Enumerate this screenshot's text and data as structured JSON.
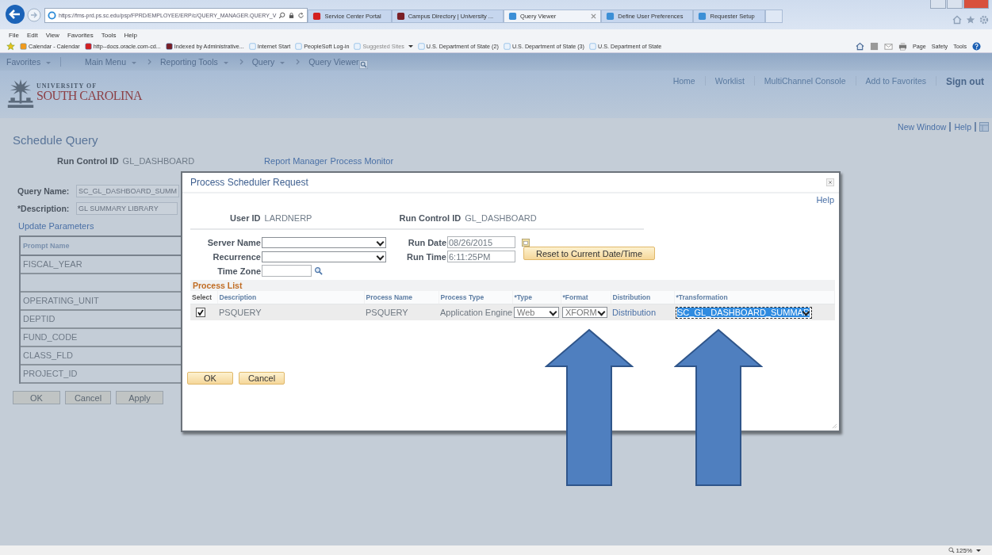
{
  "browser": {
    "address": "https://fms-prd.ps.sc.edu/psp/FPRD/EMPLOYEE/ERP/c/QUERY_MANAGER.QUERY_V",
    "tabs": [
      {
        "label": "Service Center Portal",
        "selected": false
      },
      {
        "label": "Campus Directory | University ...",
        "selected": false
      },
      {
        "label": "Query Viewer",
        "selected": true
      },
      {
        "label": "Define User Preferences",
        "selected": false
      },
      {
        "label": "Requester Setup",
        "selected": false
      }
    ],
    "menu": [
      "File",
      "Edit",
      "View",
      "Favorites",
      "Tools",
      "Help"
    ],
    "favorites": [
      {
        "label": "Calendar - Calendar",
        "dropdown": false
      },
      {
        "label": "http--docs.oracle.com-cd...",
        "dropdown": false
      },
      {
        "label": "Indexed by Administrative...",
        "dropdown": false
      },
      {
        "label": "Internet Start",
        "dropdown": false
      },
      {
        "label": "PeopleSoft Log-in",
        "dropdown": false
      },
      {
        "label": "Suggested Sites",
        "dropdown": true
      },
      {
        "label": "U.S. Department of State (2)",
        "dropdown": false
      },
      {
        "label": "U.S. Department of State (3)",
        "dropdown": false
      },
      {
        "label": "U.S. Department of State",
        "dropdown": false
      }
    ],
    "commands": [
      "Page",
      "Safety",
      "Tools"
    ],
    "zoom": "125%"
  },
  "nav": {
    "favorites": "Favorites",
    "main_menu": "Main Menu",
    "breadcrumbs": [
      {
        "label": "Reporting Tools",
        "dropdown": true
      },
      {
        "label": "Query",
        "dropdown": true
      },
      {
        "label": "Query Viewer",
        "dropdown": false
      }
    ]
  },
  "header": {
    "logo_top": "UNIVERSITY OF",
    "logo_bottom": "SOUTH CAROLINA",
    "links": [
      "Home",
      "Worklist",
      "MultiChannel Console",
      "Add to Favorites",
      "Sign out"
    ]
  },
  "page": {
    "top_links": [
      "New Window",
      "Help"
    ],
    "title": "Schedule Query",
    "run_control_label": "Run Control ID",
    "run_control_value": "GL_DASHBOARD",
    "links": [
      "Report Manager",
      "Process Monitor"
    ],
    "query_name_label": "Query Name:",
    "query_name_value": "SC_GL_DASHBOARD_SUMM",
    "description_label": "*Description:",
    "description_value": "GL SUMMARY LIBRARY",
    "update_parameters": "Update Parameters",
    "prompt_header": "Prompt Name",
    "prompts": [
      {
        "kind": "prompt",
        "name": "FISCAL_YEAR"
      },
      {
        "kind": "blank"
      },
      {
        "kind": "prompt",
        "name": "OPERATING_UNIT"
      },
      {
        "kind": "prompt",
        "name": "DEPTID"
      },
      {
        "kind": "prompt",
        "name": "FUND_CODE"
      },
      {
        "kind": "prompt",
        "name": "CLASS_FLD"
      },
      {
        "kind": "prompt",
        "name": "PROJECT_ID"
      }
    ],
    "buttons": [
      "OK",
      "Cancel",
      "Apply"
    ]
  },
  "dialog": {
    "title": "Process Scheduler Request",
    "help": "Help",
    "user_id_label": "User ID",
    "user_id": "LARDNERP",
    "run_control_label": "Run Control ID",
    "run_control": "GL_DASHBOARD",
    "server_name_label": "Server Name",
    "recurrence_label": "Recurrence",
    "time_zone_label": "Time Zone",
    "run_date_label": "Run Date",
    "run_date": "08/26/2015",
    "run_time_label": "Run Time",
    "run_time": "6:11:25PM",
    "reset_button": "Reset to Current Date/Time",
    "process_list_title": "Process List",
    "columns": [
      "Select",
      "Description",
      "Process Name",
      "Process Type",
      "*Type",
      "*Format",
      "Distribution",
      "*Transformation"
    ],
    "rows": [
      {
        "checked": true,
        "description": "PSQUERY",
        "process_name": "PSQUERY",
        "process_type": "Application Engine",
        "type": "Web",
        "format": "XFORM",
        "distribution": "Distribution",
        "transformation": "SC_GL_DASHBOARD_SUMMAR",
        "transformation_highlighted": true
      }
    ],
    "buttons": [
      "OK",
      "Cancel"
    ]
  }
}
